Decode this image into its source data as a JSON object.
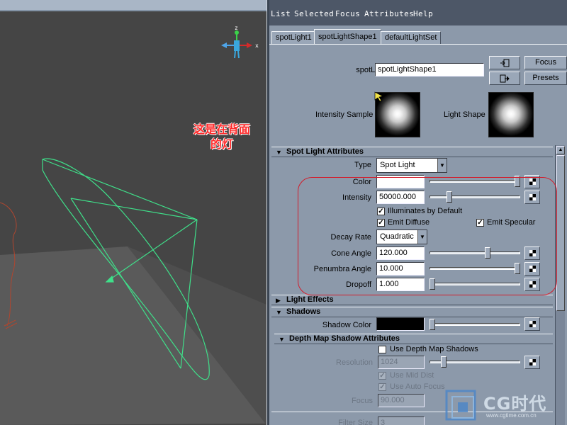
{
  "viewport": {
    "axis_labels": {
      "x": "x",
      "z": "z"
    },
    "annotation": {
      "line1": "这是在背面",
      "line2": "的灯"
    }
  },
  "menu": {
    "items": [
      "List",
      "Selected",
      "Focus",
      "Attributes",
      "Help"
    ]
  },
  "tabs": [
    "spotLight1",
    "spotLightShape1",
    "defaultLightSet"
  ],
  "active_tab_index": 1,
  "node": {
    "label": "spotLight:",
    "value": "spotLightShape1",
    "focus_button": "Focus",
    "presets_button": "Presets"
  },
  "samples": {
    "intensity_label": "Intensity Sample",
    "light_shape_label": "Light Shape"
  },
  "spot_light_attributes": {
    "title": "Spot Light Attributes",
    "type_label": "Type",
    "type_value": "Spot Light",
    "color_label": "Color",
    "color_value": "#ffffff",
    "color_slider_level": 1.0,
    "intensity_label": "Intensity",
    "intensity_value": "50000.000",
    "intensity_slider_level": 0.2,
    "illuminates_label": "Illuminates by Default",
    "illuminates_checked": true,
    "emit_diffuse_label": "Emit Diffuse",
    "emit_diffuse_checked": true,
    "emit_specular_label": "Emit Specular",
    "emit_specular_checked": true,
    "decay_rate_label": "Decay Rate",
    "decay_rate_value": "Quadratic",
    "cone_angle_label": "Cone Angle",
    "cone_angle_value": "120.000",
    "cone_angle_slider_level": 0.65,
    "penumbra_label": "Penumbra Angle",
    "penumbra_value": "10.000",
    "penumbra_slider_level": 1.0,
    "dropoff_label": "Dropoff",
    "dropoff_value": "1.000",
    "dropoff_slider_level": 0.0
  },
  "light_effects": {
    "title": "Light Effects"
  },
  "shadows": {
    "title": "Shadows",
    "shadow_color_label": "Shadow Color",
    "shadow_color_value": "#000000"
  },
  "depth_map": {
    "title": "Depth Map Shadow Attributes",
    "use_depth_label": "Use Depth Map Shadows",
    "use_depth_checked": false,
    "resolution_label": "Resolution",
    "resolution_value": "1024",
    "use_mid_dist_label": "Use Mid Dist",
    "use_mid_dist_checked": true,
    "use_auto_focus_label": "Use Auto Focus",
    "use_auto_focus_checked": true,
    "focus_label": "Focus",
    "focus_value": "90.000",
    "filter_size_label": "Filter Size",
    "filter_size_value": "3"
  },
  "watermark": {
    "text": "CG时代",
    "url": "www.cgtime.com.cn"
  },
  "colors": {
    "annotation": "#ff2a2a",
    "highlight": "#d31c2b",
    "wireframe": "#3fe08a",
    "panel": "#8c99aa",
    "menubar": "#4d5767"
  }
}
